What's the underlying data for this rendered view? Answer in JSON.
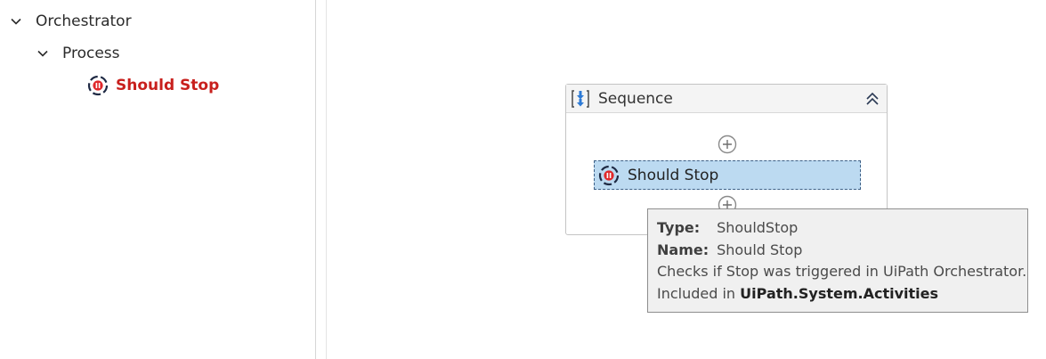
{
  "tree": {
    "root": {
      "label": "Orchestrator",
      "icon": "chevron-down-icon"
    },
    "child": {
      "label": "Process",
      "icon": "chevron-down-icon"
    },
    "activity": {
      "label": "Should Stop",
      "icon": "should-stop-icon",
      "color": "#c8201d"
    }
  },
  "designer": {
    "sequence": {
      "title": "Sequence",
      "icon": "sequence-icon",
      "collapse_icon": "double-chevron-up-icon"
    },
    "activity": {
      "label": "Should Stop",
      "icon": "should-stop-icon",
      "selected_color": "#bcdaf1"
    },
    "add_icon": "plus-circle-icon"
  },
  "tooltip": {
    "type_key": "Type:",
    "type_value": "ShouldStop",
    "name_key": "Name:",
    "name_value": "Should Stop",
    "description": "Checks if Stop was triggered in UiPath Orchestrator.",
    "included_prefix": "Included in",
    "included_package": "UiPath.System.Activities"
  }
}
